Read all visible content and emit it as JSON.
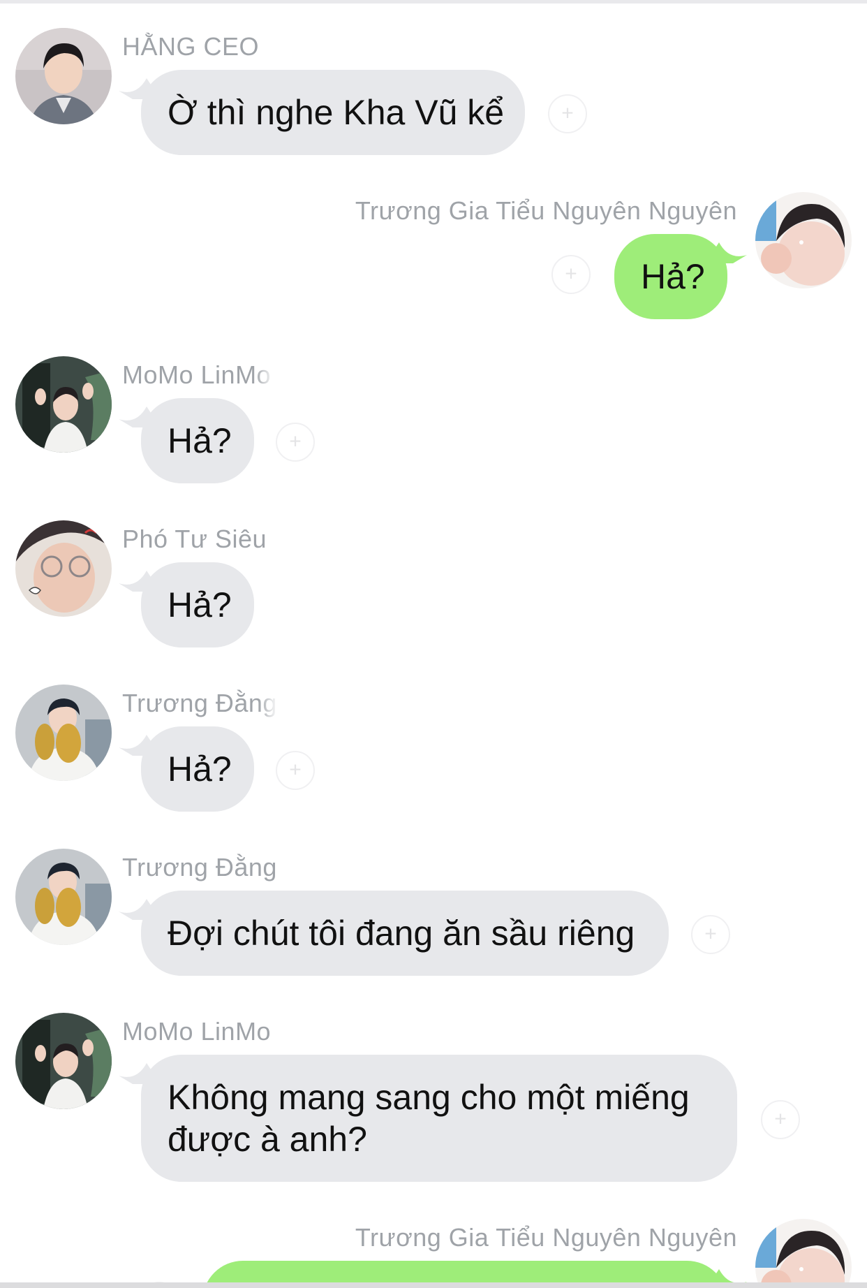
{
  "colors": {
    "incoming_bubble": "#e7e8eb",
    "outgoing_bubble": "#9eed79",
    "sender_name": "#9fa3a8",
    "background": "#ffffff"
  },
  "messages": [
    {
      "side": "left",
      "sender": "HẰNG CEO",
      "text": "Ờ thì nghe Kha Vũ kể",
      "avatar": "portrait-suit-avatar"
    },
    {
      "side": "right",
      "sender": "Trương Gia Tiểu Nguyên Nguyên",
      "text": "Hả?",
      "avatar": "portrait-smile-avatar"
    },
    {
      "side": "left",
      "sender": "MoMo LinMo",
      "text": "Hả?",
      "avatar": "portrait-wave-avatar"
    },
    {
      "side": "left",
      "sender": "Phó Tư Siêu",
      "text": "Hả?",
      "avatar": "portrait-glasses-avatar"
    },
    {
      "side": "left",
      "sender": "Trương Đằng",
      "text": "Hả?",
      "avatar": "portrait-durian-avatar"
    },
    {
      "side": "left",
      "sender": "Trương Đằng",
      "text": "Đợi chút tôi đang ăn sầu riêng",
      "avatar": "portrait-durian-avatar"
    },
    {
      "side": "left",
      "sender": "MoMo LinMo",
      "text_line1": "Không mang sang cho một miếng",
      "text_line2": "được à anh?",
      "avatar": "portrait-wave-avatar"
    },
    {
      "side": "right",
      "sender": "Trương Gia Tiểu Nguyên Nguyên",
      "text": "",
      "avatar": "portrait-smile-avatar"
    }
  ]
}
